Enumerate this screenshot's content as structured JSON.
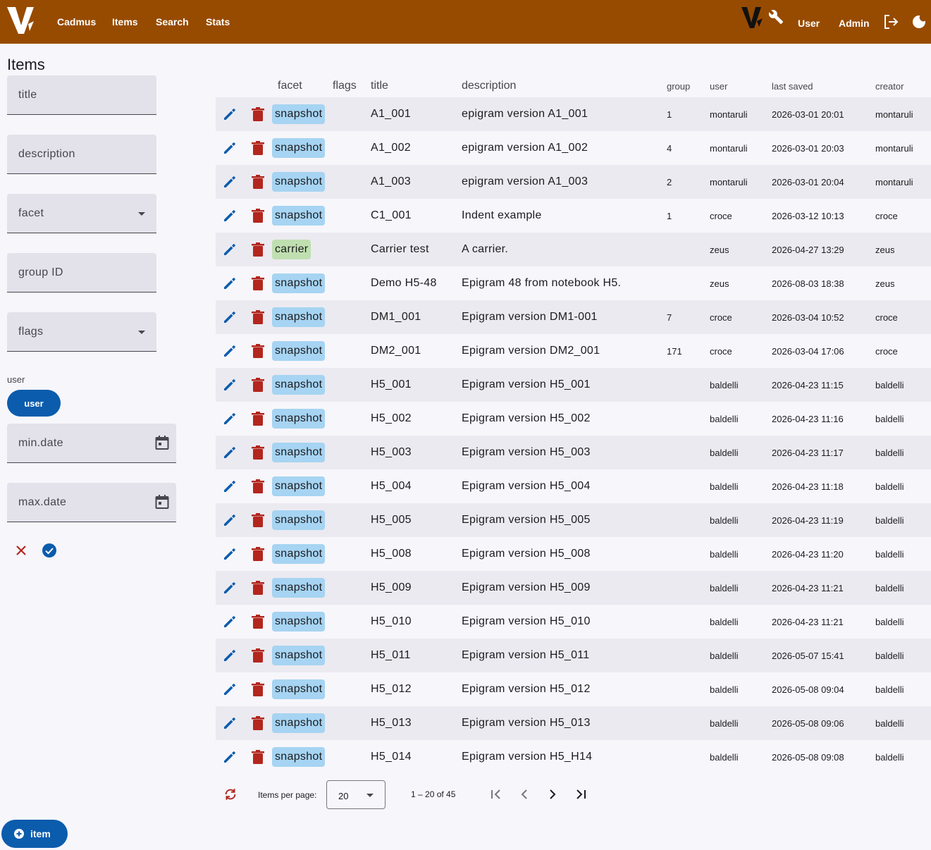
{
  "header": {
    "nav": [
      "Cadmus",
      "Items",
      "Search",
      "Stats"
    ],
    "user_label": "User",
    "admin_label": "Admin"
  },
  "sidebar": {
    "title": "Items",
    "filters": {
      "title": "title",
      "description": "description",
      "facet": "facet",
      "group_id": "group ID",
      "flags": "flags",
      "user_label": "user",
      "user_chip": "user",
      "min_date": "min.date",
      "max_date": "max.date"
    },
    "add_item": "item"
  },
  "table": {
    "headers": {
      "facet": "facet",
      "flags": "flags",
      "title": "title",
      "description": "description",
      "group": "group",
      "user": "user",
      "last_saved": "last saved",
      "creator": "creator"
    },
    "rows": [
      {
        "facet": "snapshot",
        "title": "A1_001",
        "description": "epigram version A1_001",
        "group": "1",
        "user": "montaruli",
        "saved": "2026-03-01 20:01",
        "creator": "montaruli"
      },
      {
        "facet": "snapshot",
        "title": "A1_002",
        "description": "epigram version A1_002",
        "group": "4",
        "user": "montaruli",
        "saved": "2026-03-01 20:03",
        "creator": "montaruli"
      },
      {
        "facet": "snapshot",
        "title": "A1_003",
        "description": "epigram version A1_003",
        "group": "2",
        "user": "montaruli",
        "saved": "2026-03-01 20:04",
        "creator": "montaruli"
      },
      {
        "facet": "snapshot",
        "title": "C1_001",
        "description": "Indent example",
        "group": "1",
        "user": "croce",
        "saved": "2026-03-12 10:13",
        "creator": "croce"
      },
      {
        "facet": "carrier",
        "title": "Carrier test",
        "description": "A carrier.",
        "group": "",
        "user": "zeus",
        "saved": "2026-04-27 13:29",
        "creator": "zeus"
      },
      {
        "facet": "snapshot",
        "title": "Demo H5-48",
        "description": "Epigram 48 from notebook H5.",
        "group": "",
        "user": "zeus",
        "saved": "2026-08-03 18:38",
        "creator": "zeus"
      },
      {
        "facet": "snapshot",
        "title": "DM1_001",
        "description": "Epigram version DM1-001",
        "group": "7",
        "user": "croce",
        "saved": "2026-03-04 10:52",
        "creator": "croce"
      },
      {
        "facet": "snapshot",
        "title": "DM2_001",
        "description": "Epigram version DM2_001",
        "group": "171",
        "user": "croce",
        "saved": "2026-03-04 17:06",
        "creator": "croce"
      },
      {
        "facet": "snapshot",
        "title": "H5_001",
        "description": "Epigram version H5_001",
        "group": "",
        "user": "baldelli",
        "saved": "2026-04-23 11:15",
        "creator": "baldelli"
      },
      {
        "facet": "snapshot",
        "title": "H5_002",
        "description": "Epigram version H5_002",
        "group": "",
        "user": "baldelli",
        "saved": "2026-04-23 11:16",
        "creator": "baldelli"
      },
      {
        "facet": "snapshot",
        "title": "H5_003",
        "description": "Epigram version H5_003",
        "group": "",
        "user": "baldelli",
        "saved": "2026-04-23 11:17",
        "creator": "baldelli"
      },
      {
        "facet": "snapshot",
        "title": "H5_004",
        "description": "Epigram version H5_004",
        "group": "",
        "user": "baldelli",
        "saved": "2026-04-23 11:18",
        "creator": "baldelli"
      },
      {
        "facet": "snapshot",
        "title": "H5_005",
        "description": "Epigram version H5_005",
        "group": "",
        "user": "baldelli",
        "saved": "2026-04-23 11:19",
        "creator": "baldelli"
      },
      {
        "facet": "snapshot",
        "title": "H5_008",
        "description": "Epigram version H5_008",
        "group": "",
        "user": "baldelli",
        "saved": "2026-04-23 11:20",
        "creator": "baldelli"
      },
      {
        "facet": "snapshot",
        "title": "H5_009",
        "description": "Epigram version H5_009",
        "group": "",
        "user": "baldelli",
        "saved": "2026-04-23 11:21",
        "creator": "baldelli"
      },
      {
        "facet": "snapshot",
        "title": "H5_010",
        "description": "Epigram version H5_010",
        "group": "",
        "user": "baldelli",
        "saved": "2026-04-23 11:21",
        "creator": "baldelli"
      },
      {
        "facet": "snapshot",
        "title": "H5_011",
        "description": "Epigram version H5_011",
        "group": "",
        "user": "baldelli",
        "saved": "2026-05-07 15:41",
        "creator": "baldelli"
      },
      {
        "facet": "snapshot",
        "title": "H5_012",
        "description": "Epigram version H5_012",
        "group": "",
        "user": "baldelli",
        "saved": "2026-05-08 09:04",
        "creator": "baldelli"
      },
      {
        "facet": "snapshot",
        "title": "H5_013",
        "description": "Epigram version H5_013",
        "group": "",
        "user": "baldelli",
        "saved": "2026-05-08 09:06",
        "creator": "baldelli"
      },
      {
        "facet": "snapshot",
        "title": "H5_014",
        "description": "Epigram version H5_H14",
        "group": "",
        "user": "baldelli",
        "saved": "2026-05-08 09:08",
        "creator": "baldelli"
      }
    ]
  },
  "paginator": {
    "items_per_page_label": "Items per page:",
    "page_size": "20",
    "range": "1 – 20 of 45"
  },
  "colors": {
    "header": "#974b00",
    "primary": "#0b5cad",
    "delete": "#b3261e",
    "snapshot_chip": "#a6d4f2",
    "carrier_chip": "#bfdfb0"
  },
  "icons": [
    "logo-icon",
    "wrench-icon",
    "logout-icon",
    "dark-mode-icon",
    "calendar-icon",
    "edit-icon",
    "delete-icon",
    "close-icon",
    "check-circle-icon",
    "refresh-icon",
    "first-page-icon",
    "prev-page-icon",
    "next-page-icon",
    "last-page-icon",
    "add-circle-icon"
  ]
}
